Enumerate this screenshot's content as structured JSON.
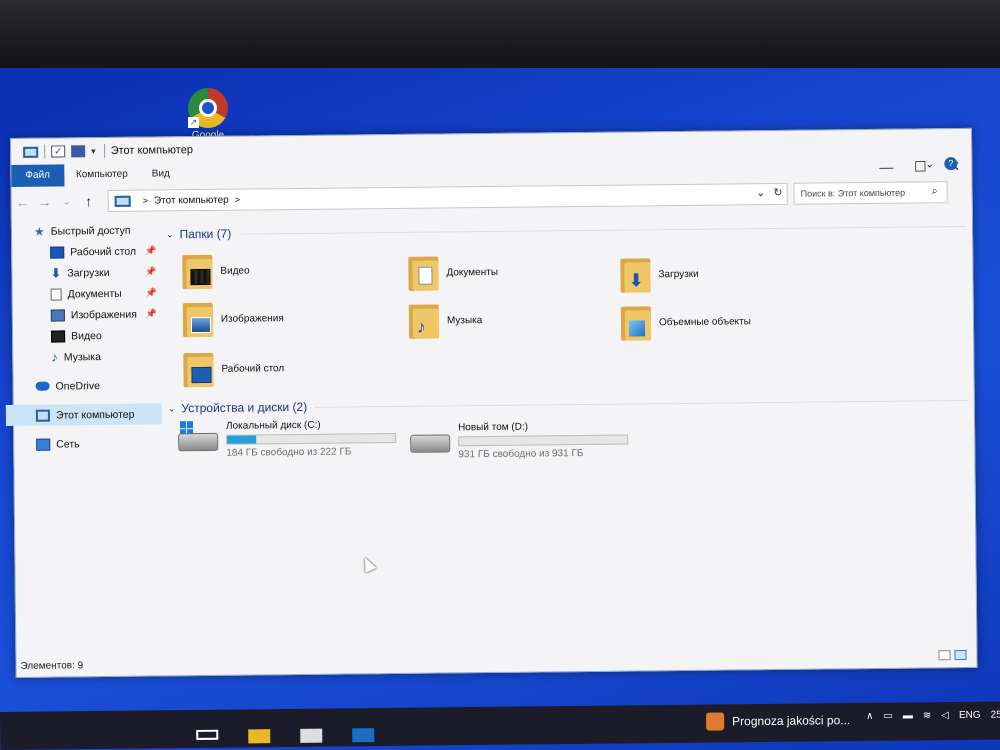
{
  "desktop": {
    "icon_label": "Google"
  },
  "window": {
    "title": "Этот компьютер",
    "controls": {
      "minimize": "—",
      "maximize": "☐",
      "close": "✕"
    },
    "ribbon_tabs": [
      "Файл",
      "Компьютер",
      "Вид"
    ],
    "address": {
      "path_label": "Этот компьютер",
      "search_placeholder": "Поиск в: Этот компьютер"
    },
    "sidebar": {
      "items": [
        {
          "label": "Быстрый доступ",
          "icon": "star-icon",
          "pinned": false
        },
        {
          "label": "Рабочий стол",
          "icon": "desktop-icon",
          "pinned": true
        },
        {
          "label": "Загрузки",
          "icon": "download-icon",
          "pinned": true
        },
        {
          "label": "Документы",
          "icon": "document-icon",
          "pinned": true
        },
        {
          "label": "Изображения",
          "icon": "images-icon",
          "pinned": true
        },
        {
          "label": "Видео",
          "icon": "video-icon",
          "pinned": false
        },
        {
          "label": "Музыка",
          "icon": "music-icon",
          "pinned": false
        },
        {
          "label": "OneDrive",
          "icon": "cloud-icon",
          "pinned": false
        },
        {
          "label": "Этот компьютер",
          "icon": "computer-icon",
          "pinned": false,
          "selected": true
        },
        {
          "label": "Сеть",
          "icon": "network-icon",
          "pinned": false
        }
      ]
    },
    "folders_group": {
      "title": "Папки (7)",
      "items": [
        {
          "label": "Видео",
          "icon": "video-folder-icon"
        },
        {
          "label": "Документы",
          "icon": "documents-folder-icon"
        },
        {
          "label": "Загрузки",
          "icon": "downloads-folder-icon"
        },
        {
          "label": "Изображения",
          "icon": "images-folder-icon"
        },
        {
          "label": "Музыка",
          "icon": "music-folder-icon"
        },
        {
          "label": "Объемные объекты",
          "icon": "3d-objects-folder-icon"
        },
        {
          "label": "Рабочий стол",
          "icon": "desktop-folder-icon"
        }
      ]
    },
    "drives_group": {
      "title": "Устройства и диски (2)",
      "items": [
        {
          "label": "Локальный диск (C:)",
          "free_text": "184 ГБ свободно из 222 ГБ",
          "used_fraction": 0.17,
          "bar_color": "#26a0da"
        },
        {
          "label": "Новый том (D:)",
          "free_text": "931 ГБ свободно из 931 ГБ",
          "used_fraction": 0.0,
          "bar_color": "#26a0da"
        }
      ]
    },
    "status": "Элементов: 9"
  },
  "taskbar": {
    "weather_text": "Prognoza jakości po...",
    "language": "ENG",
    "clock_partial": "25"
  },
  "colors": {
    "accent": "#1a5fb4",
    "selection": "#cce4f7",
    "group_heading": "#1e3287",
    "desktop": "#1a4fd8"
  }
}
